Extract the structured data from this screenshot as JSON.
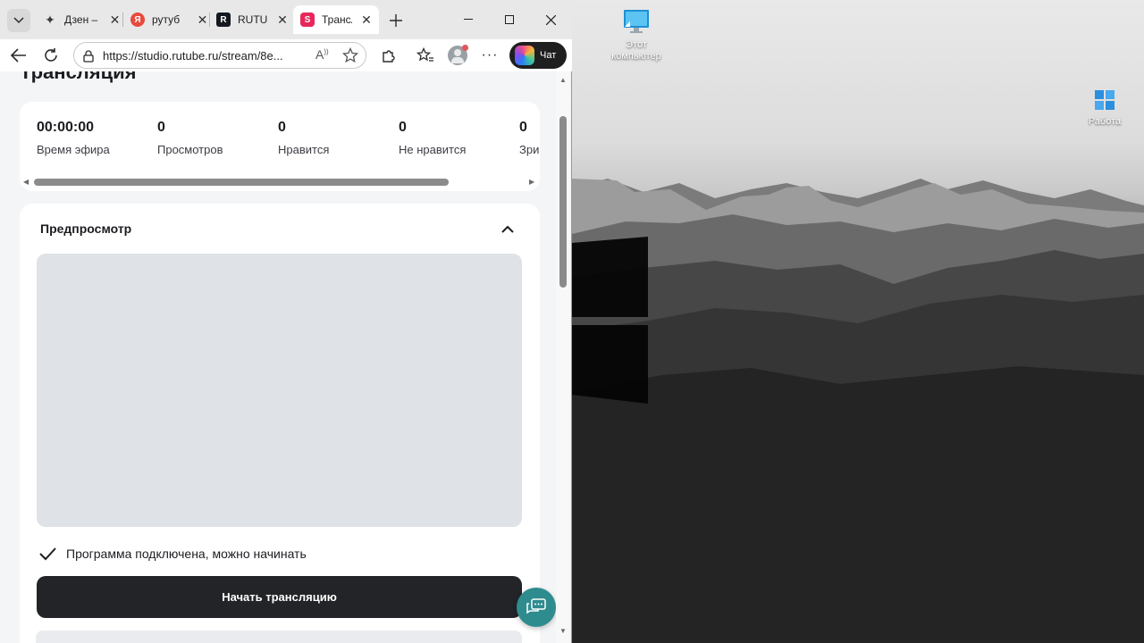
{
  "desktop": {
    "icons": [
      {
        "label": "Этот компьютер",
        "icon": "monitor-icon"
      },
      {
        "label": "Работа",
        "icon": "folder-icon"
      }
    ]
  },
  "browser": {
    "tabs": [
      {
        "title": "Дзен –",
        "favicon": "dzen-icon",
        "favicon_color": "#3a3a3a",
        "active": false
      },
      {
        "title": "рутуб",
        "favicon": "yandex-icon",
        "favicon_color": "#e84a3c",
        "favicon_text": "Я",
        "active": false
      },
      {
        "title": "RUTUBE",
        "favicon": "rutube-icon",
        "favicon_color": "#14191f",
        "favicon_text": "R",
        "active": false
      },
      {
        "title": "Трансляция",
        "favicon": "studio-icon",
        "favicon_color": "#e8285a",
        "favicon_text": "S",
        "active": true
      }
    ],
    "address": {
      "url": "https://studio.rutube.ru/stream/8e..."
    },
    "copilot_label": "Чат"
  },
  "page": {
    "heading": "Трансляция",
    "stats": [
      {
        "value": "00:00:00",
        "label": "Время эфира"
      },
      {
        "value": "0",
        "label": "Просмотров"
      },
      {
        "value": "0",
        "label": "Нравится"
      },
      {
        "value": "0",
        "label": "Не нравится"
      },
      {
        "value": "0",
        "label": "Зри"
      }
    ],
    "preview": {
      "title": "Предпросмотр",
      "status": "Программа подключена, можно начинать",
      "start_button": "Начать трансляцию"
    }
  },
  "colors": {
    "accent_dark": "#222427",
    "chat_fab": "#2e8c8f",
    "preview_bg": "#dfe2e6"
  }
}
